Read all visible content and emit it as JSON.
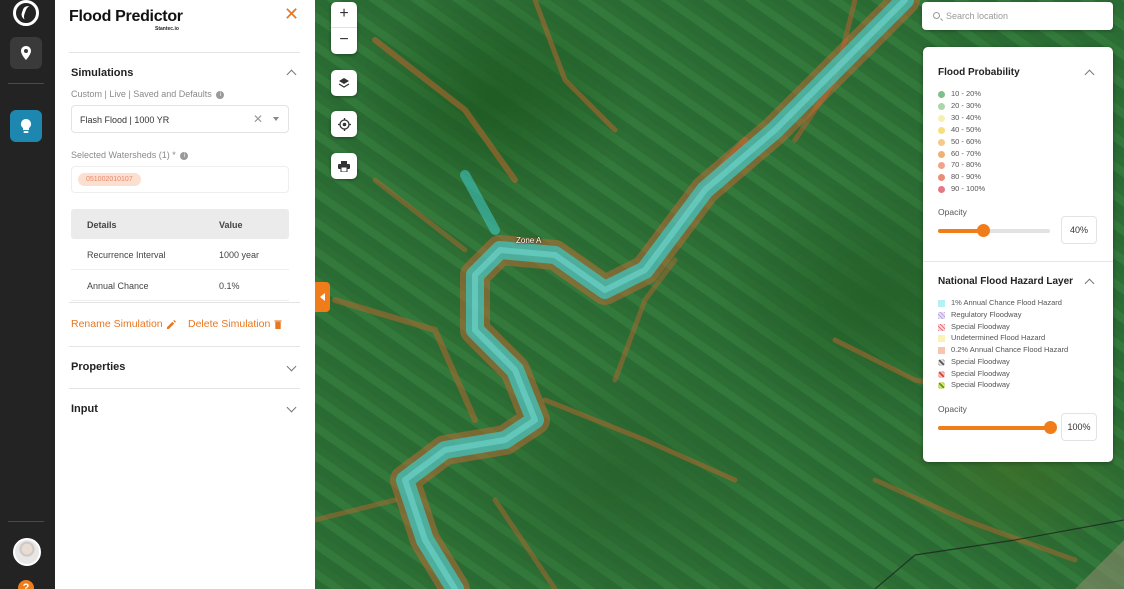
{
  "app": {
    "title": "Flood Predictor",
    "subtitle": "Stantec.io",
    "accent": "#f07d1a"
  },
  "rail": {
    "items": [
      {
        "icon": "stantec-logo-icon"
      },
      {
        "icon": "map-pin-icon"
      },
      {
        "icon": "lightbulb-icon",
        "active": true
      },
      {
        "icon": "avatar"
      },
      {
        "icon": "help-icon"
      }
    ]
  },
  "simulations": {
    "title": "Simulations",
    "source_label": "Custom | Live | Saved and Defaults",
    "selected_simulation": "Flash Flood | 1000 YR",
    "watersheds_label": "Selected Watersheds (1) *",
    "watershed_chip": "051002010107",
    "table": {
      "headers": [
        "Details",
        "Value"
      ],
      "rows": [
        {
          "detail": "Recurrence Interval",
          "value": "1000 year"
        },
        {
          "detail": "Annual Chance",
          "value": "0.1%"
        }
      ]
    },
    "rename_label": "Rename Simulation",
    "delete_label": "Delete Simulation"
  },
  "properties": {
    "title": "Properties"
  },
  "input": {
    "title": "Input"
  },
  "map": {
    "zoom_in": "+",
    "zoom_out": "−",
    "zone_label": "Zone A",
    "search_placeholder": "Search location"
  },
  "flood_probability": {
    "title": "Flood Probability",
    "items": [
      {
        "label": "10 - 20%",
        "color": "#7fbf8a"
      },
      {
        "label": "20 - 30%",
        "color": "#a9d8a6"
      },
      {
        "label": "30 - 40%",
        "color": "#f6f0b0"
      },
      {
        "label": "40 - 50%",
        "color": "#f7e07a"
      },
      {
        "label": "50 - 60%",
        "color": "#f6c98a"
      },
      {
        "label": "60 - 70%",
        "color": "#f2b070"
      },
      {
        "label": "70 - 80%",
        "color": "#efa48a"
      },
      {
        "label": "80 - 90%",
        "color": "#e98d7a"
      },
      {
        "label": "90 - 100%",
        "color": "#e27a85"
      }
    ],
    "opacity_label": "Opacity",
    "opacity_value": "40%",
    "opacity_fraction": 0.4
  },
  "nfhl": {
    "title": "National Flood Hazard Layer",
    "items": [
      {
        "label": "1% Annual Chance Flood Hazard",
        "color": "#b7f0f4"
      },
      {
        "label": "Regulatory Floodway",
        "color": "#d9c9ee"
      },
      {
        "label": "Special Floodway",
        "color": "#f3b3b8"
      },
      {
        "label": "Undetermined Flood Hazard",
        "color": "#fbf2b6"
      },
      {
        "label": "0.2% Annual Chance Flood Hazard",
        "color": "#f8c4b0"
      },
      {
        "label": "Special Floodway",
        "color": "#6a6a6a"
      },
      {
        "label": "Special Floodway",
        "color": "#d0443c"
      },
      {
        "label": "Special Floodway",
        "color": "#4c9a3c"
      }
    ],
    "opacity_label": "Opacity",
    "opacity_value": "100%",
    "opacity_fraction": 1.0
  }
}
